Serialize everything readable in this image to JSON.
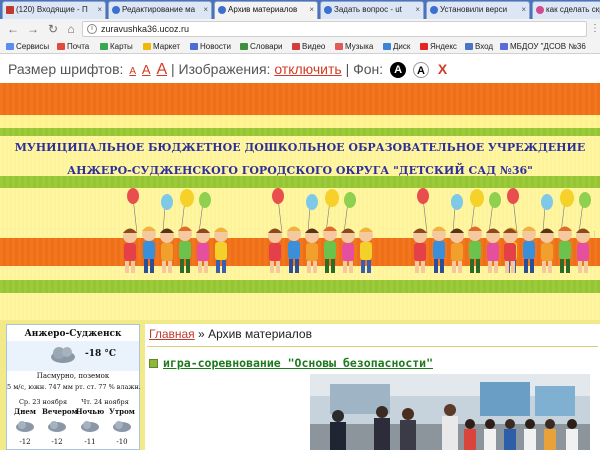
{
  "browser": {
    "tabs": [
      {
        "label": "(120) Входящие - П",
        "active": false
      },
      {
        "label": "Редактирование ма",
        "active": false
      },
      {
        "label": "Архив материалов",
        "active": true
      },
      {
        "label": "Задать вопрос - ut",
        "active": false
      },
      {
        "label": "Установили верси",
        "active": false
      },
      {
        "label": "как сделать скр",
        "active": false
      }
    ],
    "url": "zuravushka36.ucoz.ru",
    "bookmarks": [
      {
        "label": "Сервисы",
        "color": "#5b8def"
      },
      {
        "label": "Почта",
        "color": "#e04b3c"
      },
      {
        "label": "Карты",
        "color": "#3aa757"
      },
      {
        "label": "Маркет",
        "color": "#f2b705"
      },
      {
        "label": "Новости",
        "color": "#4a6cd4"
      },
      {
        "label": "Словари",
        "color": "#3f8f3f"
      },
      {
        "label": "Видео",
        "color": "#d43c3c"
      },
      {
        "label": "Музыка",
        "color": "#e05a5a"
      },
      {
        "label": "Диск",
        "color": "#3b83d6"
      },
      {
        "label": "Яндекс",
        "color": "#e52620"
      },
      {
        "label": "Вход",
        "color": "#4a75c8"
      },
      {
        "label": "МБДОУ \"ДСОВ №36",
        "color": "#5b6bd6"
      }
    ]
  },
  "accessibility": {
    "font_size_label": "Размер шрифтов:",
    "size_small": "А",
    "size_medium": "А",
    "size_large": "А",
    "images_label": "Изображения:",
    "images_toggle": "отключить",
    "background_label": "Фон:",
    "bg_black": "А",
    "bg_white": "А",
    "bg_reset": "X"
  },
  "header": {
    "line1": "МУНИЦИПАЛЬНОЕ БЮДЖЕТНОЕ ДОШКОЛЬНОЕ ОБРАЗОВАТЕЛЬНОЕ УЧРЕЖДЕНИЕ",
    "line2": "АНЖЕРО-СУДЖЕНСКОГО ГОРОДСКОГО ОКРУГА \"ДЕТСКИЙ САД №36\"",
    "colors": {
      "orange": "#f1761e",
      "green": "#9ccb3a",
      "yellow": "#fff596",
      "title": "#2b2f9c"
    }
  },
  "weather": {
    "city": "Анжеро-Судженск",
    "now_temp": "-18 °C",
    "condition": "Пасмурно, поземок",
    "details": "5 м/с, южн.   747 мм рт. ст.   77 % влажн.",
    "day1": "Ср. 23 ноября",
    "day2": "Чт. 24 ноября",
    "parts": [
      "Днем",
      "Вечером",
      "Ночью",
      "Утром"
    ],
    "temps": [
      "-12",
      "-12",
      "-11",
      "-10"
    ]
  },
  "content": {
    "breadcrumb_home": "Главная",
    "breadcrumb_sep": "»",
    "breadcrumb_current": "Архив материалов",
    "post_title": "игра-соревнование \"Основы безопасности\""
  }
}
